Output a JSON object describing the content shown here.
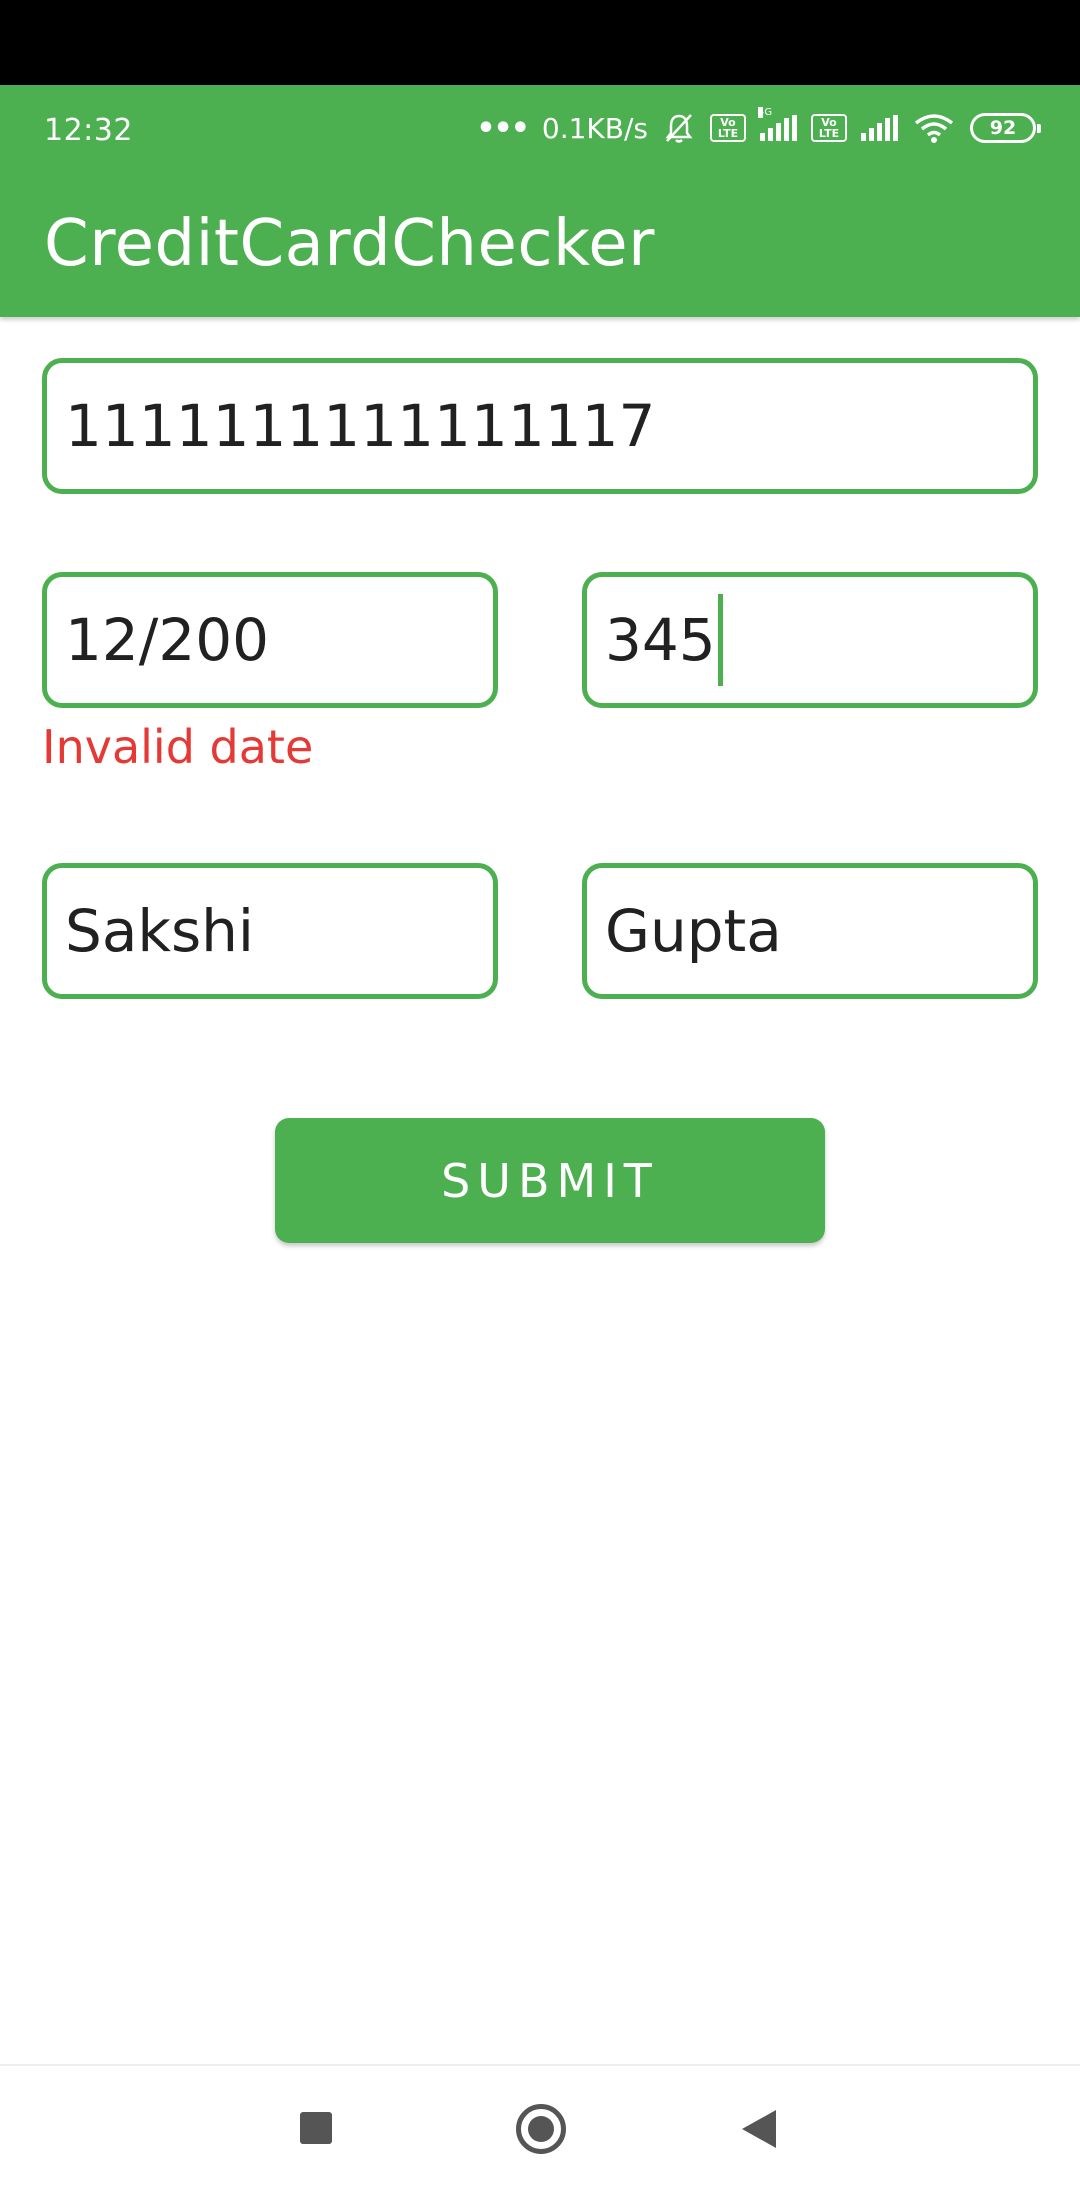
{
  "status_bar": {
    "time": "12:32",
    "dots": "•••",
    "network_speed": "0.1KB/s",
    "volte_label_1": "Vo\nLTE",
    "network_type": "4G",
    "volte_label_2": "Vo\nLTE",
    "battery_level": "92",
    "icons": [
      "mute-bell-icon",
      "volte-icon",
      "signal-icon",
      "volte-icon",
      "signal-icon",
      "wifi-icon",
      "battery-icon"
    ]
  },
  "app_bar": {
    "title": "CreditCardChecker"
  },
  "form": {
    "card_number": "1111111111111117",
    "expiry_date": "12/200",
    "expiry_error": "Invalid date",
    "cvv": "345",
    "first_name": "Sakshi",
    "last_name": "Gupta",
    "submit_label": "SUBMIT"
  },
  "nav_bar": {
    "icons": [
      "recents-icon",
      "home-icon",
      "back-icon"
    ]
  },
  "colors": {
    "primary": "#4caf50",
    "error": "#e53935",
    "text": "#212121"
  }
}
